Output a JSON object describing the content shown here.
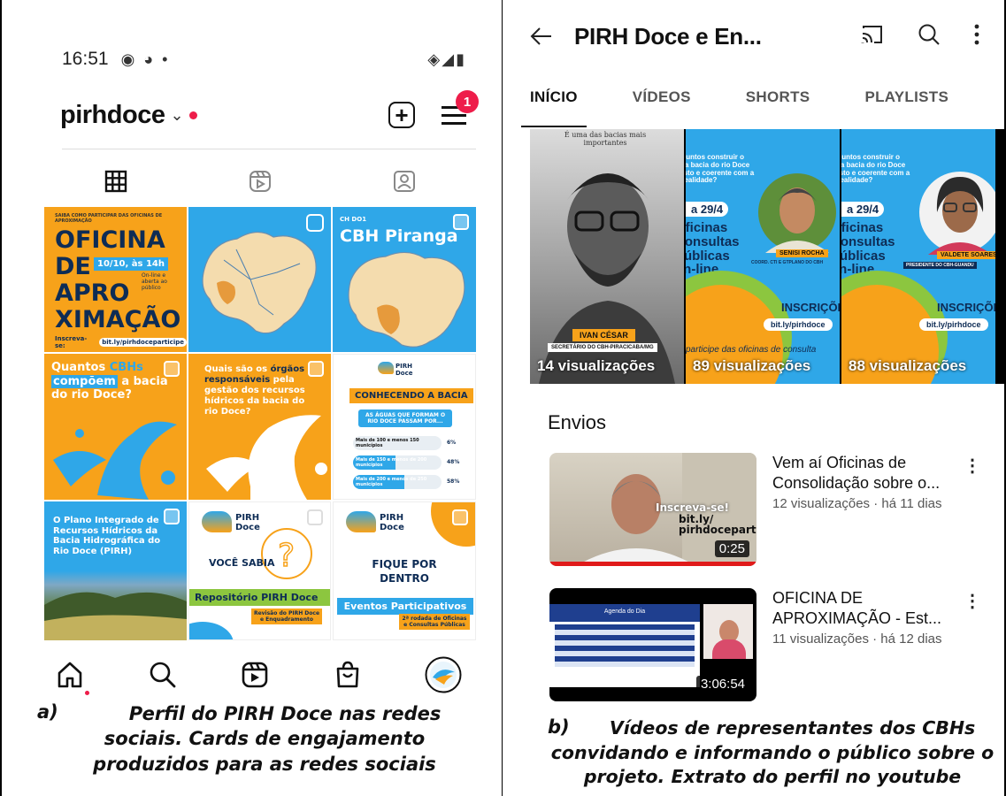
{
  "instagram": {
    "status": {
      "time": "16:51",
      "signal": "◈◢▮"
    },
    "username": "pirhdoce",
    "badge_count": "1",
    "tiles": {
      "t1": {
        "small": "SAIBA COMO PARTICIPAR DAS OFICINAS DE APROXIMAÇÃO",
        "l1": "OFICINA",
        "l2": "DE",
        "l3": "APRO",
        "l4": "XIMAÇÃO",
        "date": "10/10, às 14h",
        "note": "On-line e aberta ao público",
        "cta": "Inscreva-se:",
        "link": "bit.ly/pirhdoceparticipe"
      },
      "t3": {
        "small": "CH DO1",
        "title": "CBH Piranga"
      },
      "t4": {
        "a": "Quantos ",
        "b": "CBHs",
        "c": "compõem",
        "d": " a bacia do rio Doce?"
      },
      "t5": {
        "a": "Quais são os ",
        "b": "órgãos responsáveis",
        "c": " pela gestão dos recursos hídricos da bacia do rio Doce?"
      },
      "t6": {
        "brand": "PIRH Doce",
        "head": "CONHECENDO A BACIA",
        "q": "AS ÁGUAS QUE FORMAM O RIO DOCE PASSAM POR...",
        "r1": "Mais de 100 e menos 150 municípios",
        "v1": "6%",
        "r2": "Mais de 150 e menos de 200 municípios",
        "v2": "48%",
        "r3": "Mais de 200 e menos de 250 municípios",
        "v3": "58%"
      },
      "t7": {
        "text": "O Plano Integrado de Recursos Hídricos da Bacia Hidrográfica do Rio Doce (PIRH)"
      },
      "t8": {
        "brand": "PIRH Doce",
        "title": "VOCÊ SABIA",
        "band": "Repositório PIRH Doce",
        "sub": "Revisão do PIRH Doce e Enquadramento"
      },
      "t9": {
        "brand": "PIRH Doce",
        "title": "FIQUE POR DENTRO",
        "band": "Eventos Participativos",
        "sub": "2ª rodada de Oficinas e Consultas Públicas"
      }
    },
    "caption_letter": "a)",
    "caption": "Perfil do PIRH Doce nas redes sociais. Cards de engajamento produzidos para as redes sociais"
  },
  "youtube": {
    "title": "PIRH Doce e En...",
    "tabs": [
      "INÍCIO",
      "VÍDEOS",
      "SHORTS",
      "PLAYLISTS"
    ],
    "shorts": [
      {
        "top_text": "É uma das bacias mais importantes",
        "name": "IVAN CÉSAR",
        "role": "SECRETÁRIO DO CBH-PIRACICABA/MG",
        "views": "14 visualizações"
      },
      {
        "head": "Vamos juntos construir o Plano da bacia do rio Doce mais justo e coerente com a nossa realidade?",
        "date": "a 29/4",
        "big": "Oficinas Consultas Públicas on-line",
        "name": "SENISI ROCHA",
        "role": "COORD. CTI E GTPLANO DO CBH",
        "cta": "INSCRIÇÕES",
        "link": "bit.ly/pirhdoce",
        "caption": "participe das oficinas de consulta",
        "views": "89 visualizações"
      },
      {
        "head": "Vamos juntos construir o Plano da bacia do rio Doce mais justo e coerente com a nossa realidade?",
        "date": "a 29/4",
        "big": "Oficinas Consultas Públicas on-line",
        "name": "VALDETE SOARES",
        "role": "PRESIDENTE DO CBH-GUANDU",
        "cta": "INSCRIÇÕES",
        "link": "bit.ly/pirhdoce",
        "views": "88 visualizações"
      }
    ],
    "section": "Envios",
    "videos": [
      {
        "title1": "Vem aí Oficinas de",
        "title2": "Consolidação sobre o...",
        "meta": "12 visualizações · há 11 dias",
        "duration": "0:25",
        "overlay1": "Inscreva-se!",
        "overlay2": "bit.ly/",
        "overlay3": "pirhdoceparticipe"
      },
      {
        "title1": "OFICINA DE",
        "title2": "APROXIMAÇÃO - Est...",
        "meta": "11 visualizações · há 12 dias",
        "duration": "3:06:54",
        "slide_title": "Agenda do Dia"
      }
    ],
    "caption_letter": "b)",
    "caption": "Vídeos de representantes dos CBHs convidando e informando o público sobre o projeto. Extrato do perfil no youtube"
  }
}
